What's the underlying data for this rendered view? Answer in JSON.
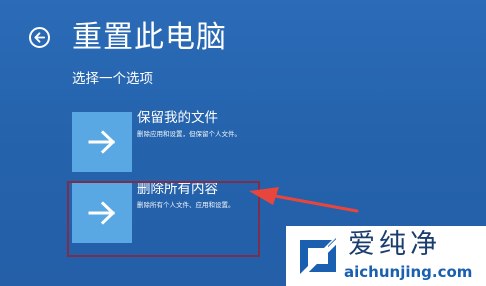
{
  "header": {
    "title": "重置此电脑",
    "back_icon": "back-arrow-icon"
  },
  "subtitle": "选择一个选项",
  "options": [
    {
      "title": "保留我的文件",
      "description": "删除应用和设置，但保留个人文件。",
      "icon": "right-arrow-icon"
    },
    {
      "title": "删除所有内容",
      "description": "删除所有个人文件、应用和设置。",
      "icon": "right-arrow-icon"
    }
  ],
  "annotation": {
    "highlight_color": "#7c2f4a",
    "arrow_color": "#e8463c"
  },
  "watermark": {
    "brand": "爱纯净",
    "url": "aichunjing.com"
  },
  "colors": {
    "background": "#2563ad",
    "tile": "#5aa8e3",
    "text": "#ffffff"
  }
}
